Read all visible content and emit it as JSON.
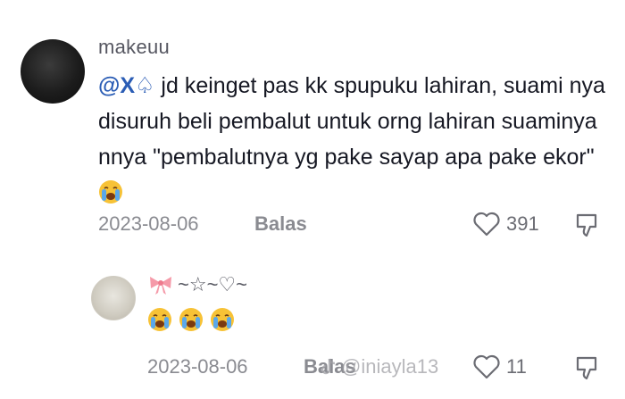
{
  "comment": {
    "username": "makeuu",
    "mention": "@X♤",
    "text": "jd keinget pas kk spupuku lahiran, suami nya disuruh beli pembalut untuk orng lahiran suaminya nnya \"pembalutnya yg pake sayap apa pake ekor\"",
    "emoji": "loudly-crying-face",
    "date": "2023-08-06",
    "reply_label": "Balas",
    "likes": "391"
  },
  "reply": {
    "username": "~☆~♡~",
    "bow_icon": "ribbon-bow-icon",
    "emojis": [
      "loudly-crying-face",
      "loudly-crying-face",
      "loudly-crying-face"
    ],
    "date": "2023-08-06",
    "reply_label": "Balas",
    "likes": "11"
  },
  "watermark": {
    "handle": "@iniayla13"
  },
  "colors": {
    "mention": "#2b5db5",
    "meta": "#8a8b91",
    "text": "#161823"
  }
}
